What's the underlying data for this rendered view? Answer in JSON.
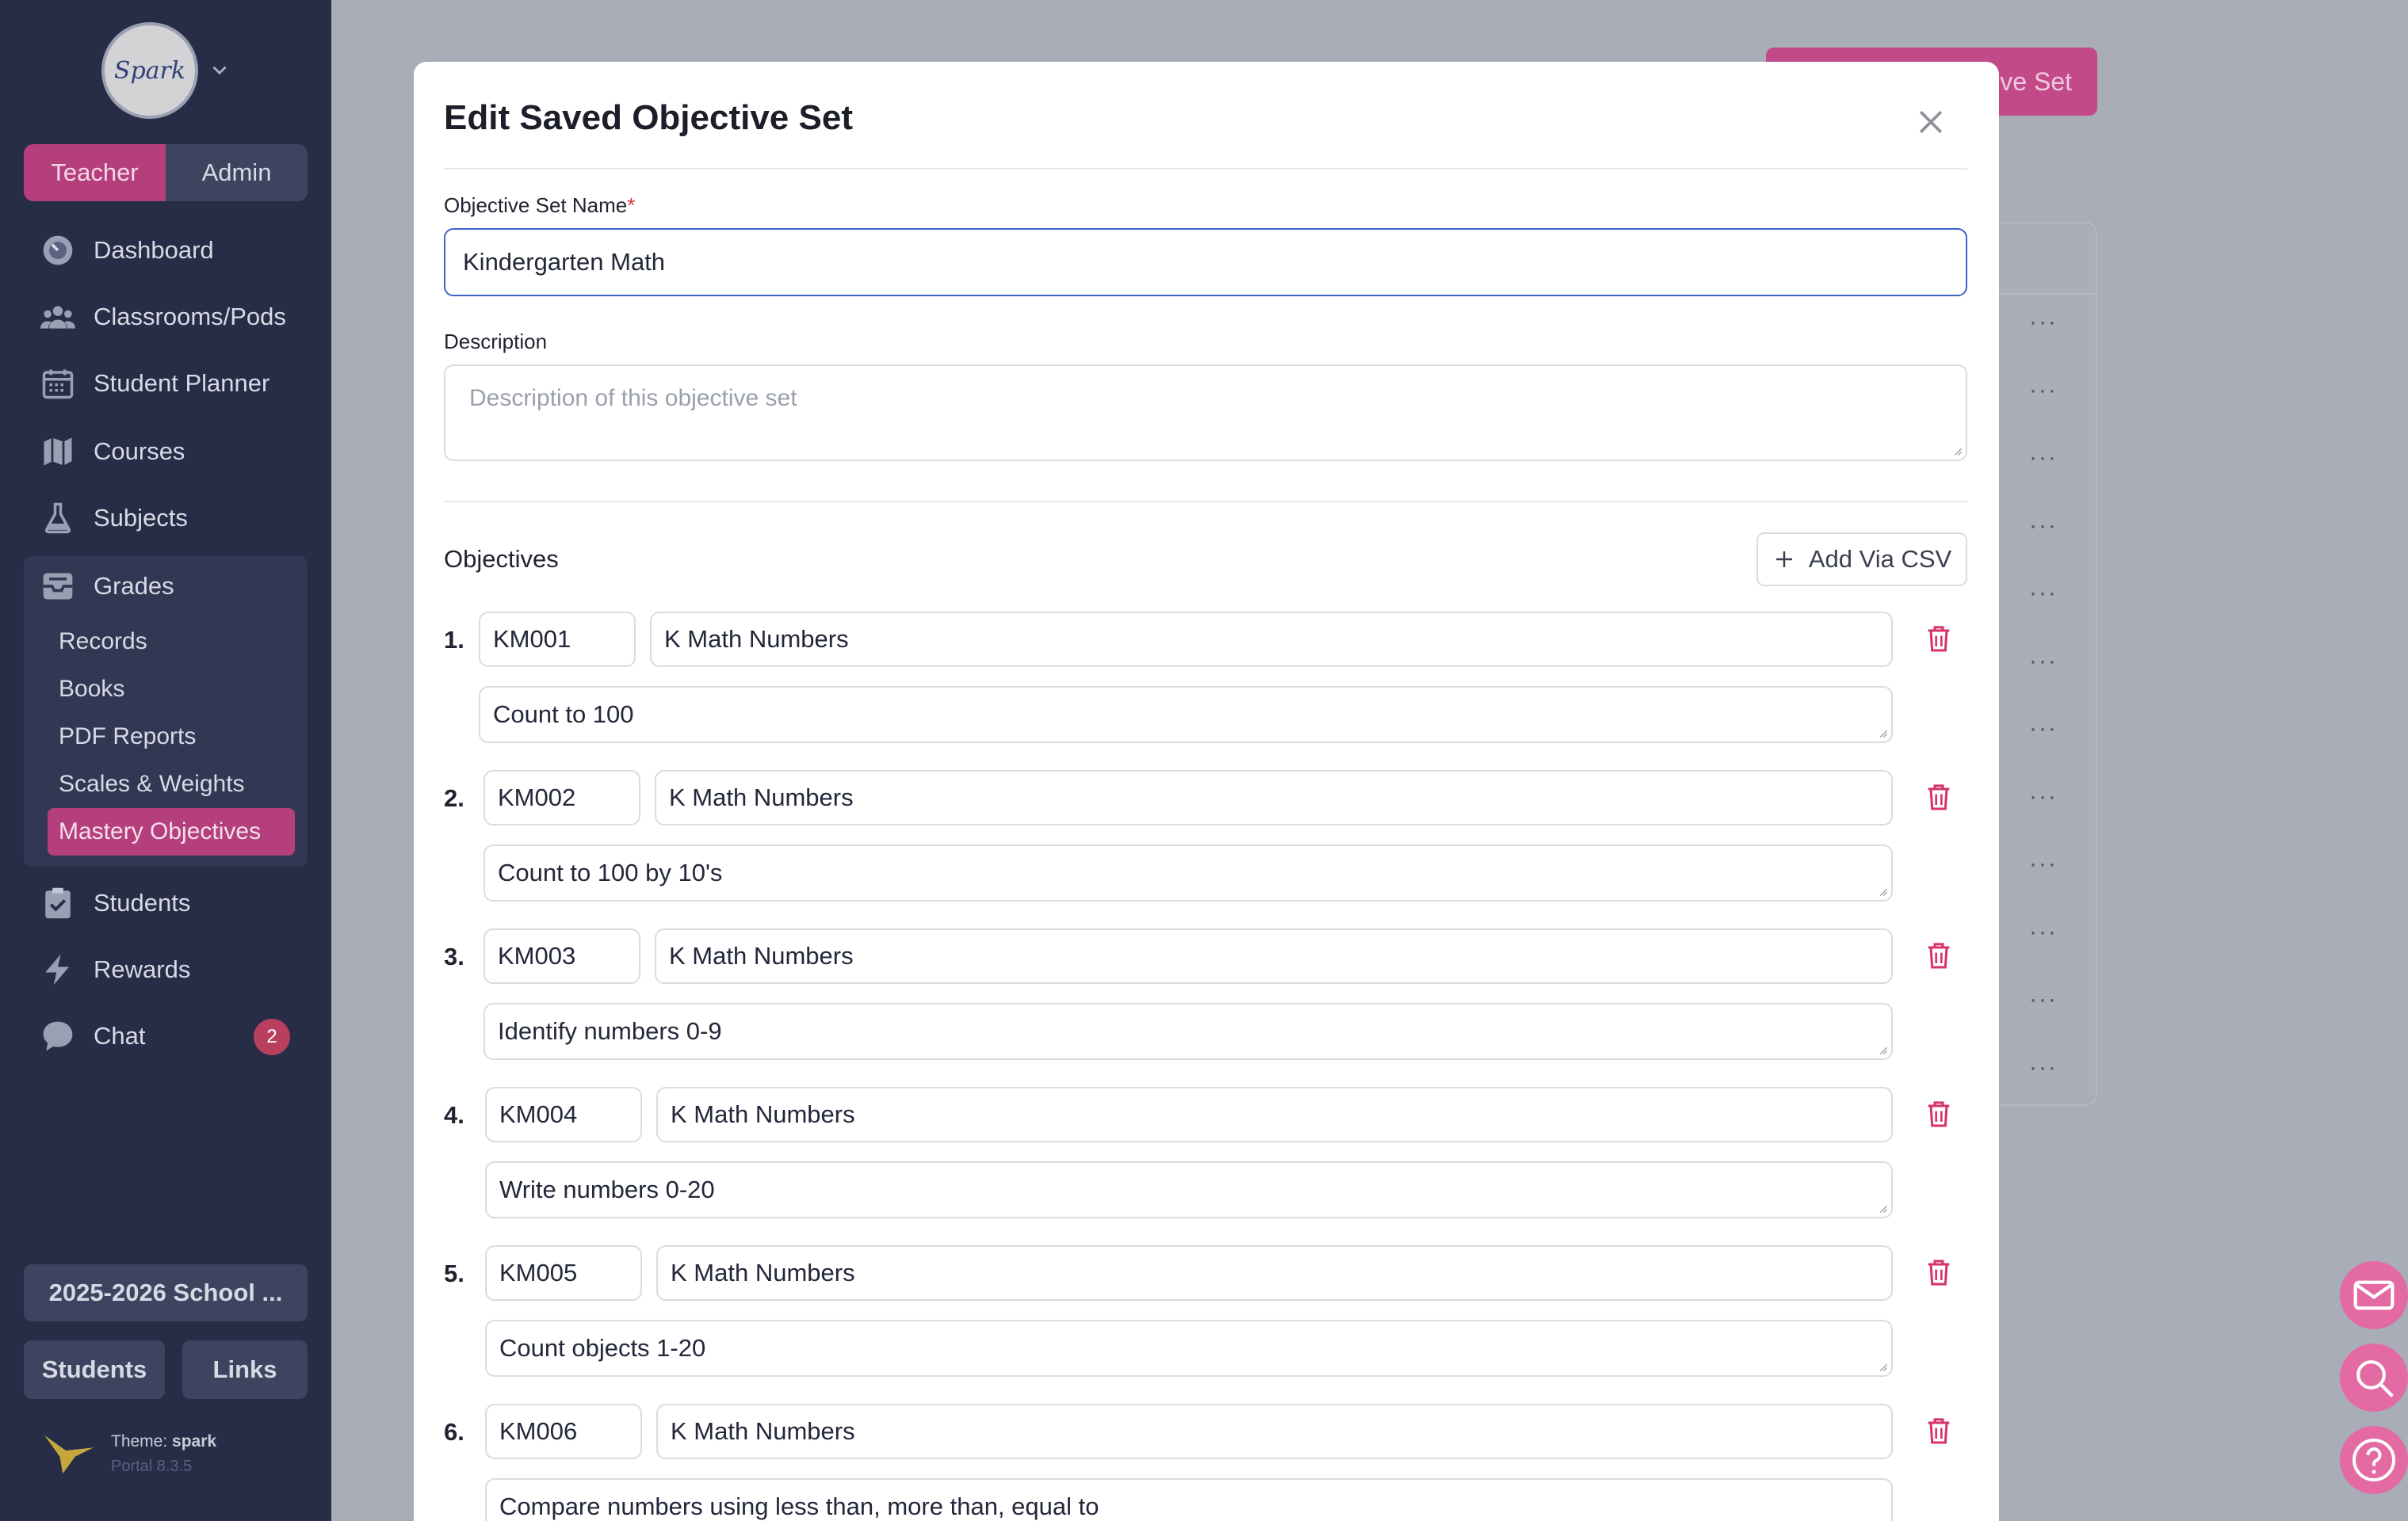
{
  "sidebar": {
    "logo_text": "Spark",
    "roles": [
      {
        "label": "Teacher",
        "active": true
      },
      {
        "label": "Admin",
        "active": false
      }
    ],
    "nav": [
      {
        "label": "Dashboard",
        "icon": "gauge-icon"
      },
      {
        "label": "Classrooms/Pods",
        "icon": "users-icon"
      },
      {
        "label": "Student Planner",
        "icon": "calendar-icon"
      },
      {
        "label": "Courses",
        "icon": "map-icon"
      },
      {
        "label": "Subjects",
        "icon": "flask-icon"
      },
      {
        "label": "Grades",
        "icon": "inbox-icon"
      }
    ],
    "grades_sub": [
      "Records",
      "Books",
      "PDF Reports",
      "Scales & Weights",
      "Mastery Objectives"
    ],
    "nav_bottom": [
      {
        "label": "Students",
        "icon": "clipboard-icon"
      },
      {
        "label": "Rewards",
        "icon": "bolt-icon"
      },
      {
        "label": "Chat",
        "icon": "chat-icon"
      }
    ],
    "chat_badge": "2",
    "school_year": "2025-2026 School ...",
    "students_btn": "Students",
    "links_btn": "Links",
    "theme_label": "Theme:",
    "theme_name": "spark",
    "version": "Portal 8.3.5"
  },
  "background": {
    "button_label": "ive Set"
  },
  "modal": {
    "title": "Edit Saved Objective Set",
    "name_label": "Objective Set Name",
    "required_mark": "*",
    "name_value": "Kindergarten Math",
    "description_label": "Description",
    "description_placeholder": "Description of this objective set",
    "objectives_label": "Objectives",
    "add_csv_label": "Add Via CSV",
    "objectives": [
      {
        "num": "1.",
        "code": "KM001",
        "category": "K Math Numbers",
        "desc": "Count to 100"
      },
      {
        "num": "2.",
        "code": "KM002",
        "category": "K Math Numbers",
        "desc": "Count to 100 by 10's"
      },
      {
        "num": "3.",
        "code": "KM003",
        "category": "K Math Numbers",
        "desc": "Identify numbers 0-9"
      },
      {
        "num": "4.",
        "code": "KM004",
        "category": "K Math Numbers",
        "desc": "Write numbers 0-20"
      },
      {
        "num": "5.",
        "code": "KM005",
        "category": "K Math Numbers",
        "desc": "Count objects 1-20"
      },
      {
        "num": "6.",
        "code": "KM006",
        "category": "K Math Numbers",
        "desc": "Compare numbers using less than, more than, equal to"
      }
    ]
  },
  "colors": {
    "accent": "#b53f7c",
    "sidebar": "#272d47",
    "focus": "#3e63c8",
    "danger": "#d6336c"
  }
}
